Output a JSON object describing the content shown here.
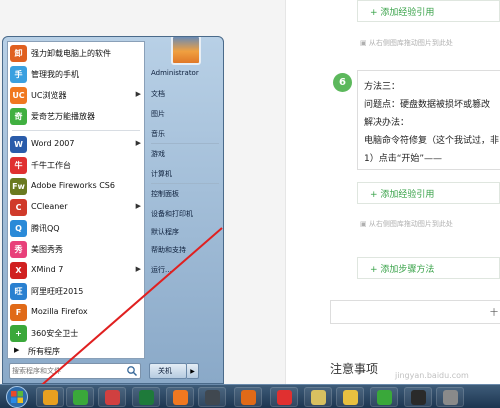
{
  "page": {
    "add_reference_label": "添加经验引用",
    "drag_note": "从右侧图库拖动图片到此处",
    "step_number": "6",
    "step_lines": [
      "方法三：",
      "问题点：硬盘数据被损坏或篡改",
      "解决办法：",
      "电脑命令符修复（这个我试过，非",
      "1）点击“开始”——"
    ],
    "add_step_label": "添加步骤方法",
    "bottom_box_text": "十",
    "notes_title": "注意事项",
    "watermark": "jingyan.baidu.com"
  },
  "start_menu": {
    "programs": [
      {
        "label": "强力卸载电脑上的软件",
        "icon": "uninstaller-icon",
        "color": "#e06020",
        "glyph": "卸",
        "arrow": false
      },
      {
        "label": "管理我的手机",
        "icon": "phone-manager-icon",
        "color": "#3aa0e0",
        "glyph": "手",
        "arrow": false
      },
      {
        "label": "UC浏览器",
        "icon": "uc-browser-icon",
        "color": "#f07820",
        "glyph": "UC",
        "arrow": true
      },
      {
        "label": "爱奇艺万能播放器",
        "icon": "iqiyi-player-icon",
        "color": "#40b040",
        "glyph": "奇",
        "arrow": false
      },
      {
        "label": "Word 2007",
        "icon": "word-icon",
        "color": "#2a5caa",
        "glyph": "W",
        "arrow": true
      },
      {
        "label": "千牛工作台",
        "icon": "qianniu-icon",
        "color": "#e03030",
        "glyph": "牛",
        "arrow": false
      },
      {
        "label": "Adobe Fireworks CS6",
        "icon": "fireworks-icon",
        "color": "#6a7a20",
        "glyph": "Fw",
        "arrow": false
      },
      {
        "label": "CCleaner",
        "icon": "ccleaner-icon",
        "color": "#d03a2a",
        "glyph": "C",
        "arrow": true
      },
      {
        "label": "腾讯QQ",
        "icon": "qq-icon",
        "color": "#2a8ad8",
        "glyph": "Q",
        "arrow": false
      },
      {
        "label": "美图秀秀",
        "icon": "meitu-icon",
        "color": "#e8407a",
        "glyph": "秀",
        "arrow": false
      },
      {
        "label": "XMind 7",
        "icon": "xmind-icon",
        "color": "#d02020",
        "glyph": "X",
        "arrow": true
      },
      {
        "label": "阿里旺旺2015",
        "icon": "aliwangwang-icon",
        "color": "#2a80d0",
        "glyph": "旺",
        "arrow": false
      },
      {
        "label": "Mozilla Firefox",
        "icon": "firefox-icon",
        "color": "#e06a18",
        "glyph": "F",
        "arrow": false
      },
      {
        "label": "360安全卫士",
        "icon": "360-security-icon",
        "color": "#3aa83a",
        "glyph": "+",
        "arrow": false
      }
    ],
    "all_programs_label": "所有程序",
    "search_placeholder": "搜索程序和文件",
    "right_items": [
      "Administrator",
      "文档",
      "图片",
      "音乐",
      "游戏",
      "计算机",
      "控制面板",
      "设备和打印机",
      "默认程序",
      "帮助和支持",
      "运行..."
    ],
    "shutdown_label": "关机"
  },
  "taskbar": {
    "icons": [
      {
        "name": "taskbar-app-pinwheel-icon",
        "color": "#e8a020"
      },
      {
        "name": "taskbar-app-green-icon",
        "color": "#3aa83a"
      },
      {
        "name": "taskbar-app-ball-icon",
        "color": "#d04040"
      },
      {
        "name": "taskbar-app-excel-icon",
        "color": "#1e7a3a"
      },
      {
        "name": "taskbar-app-uc-icon",
        "color": "#f07820"
      },
      {
        "name": "taskbar-app-media-icon",
        "color": "#404850"
      },
      {
        "name": "taskbar-app-firefox-icon",
        "color": "#e06a18"
      },
      {
        "name": "taskbar-app-qianniu-icon",
        "color": "#e03030"
      },
      {
        "name": "taskbar-app-notes-icon",
        "color": "#d8c060"
      },
      {
        "name": "taskbar-app-explorer-icon",
        "color": "#e8c040"
      },
      {
        "name": "taskbar-app-360-icon",
        "color": "#3aa83a"
      },
      {
        "name": "taskbar-app-window-icon",
        "color": "#2a2a2a"
      },
      {
        "name": "taskbar-app-photo-icon",
        "color": "#8a8a8a"
      }
    ]
  }
}
